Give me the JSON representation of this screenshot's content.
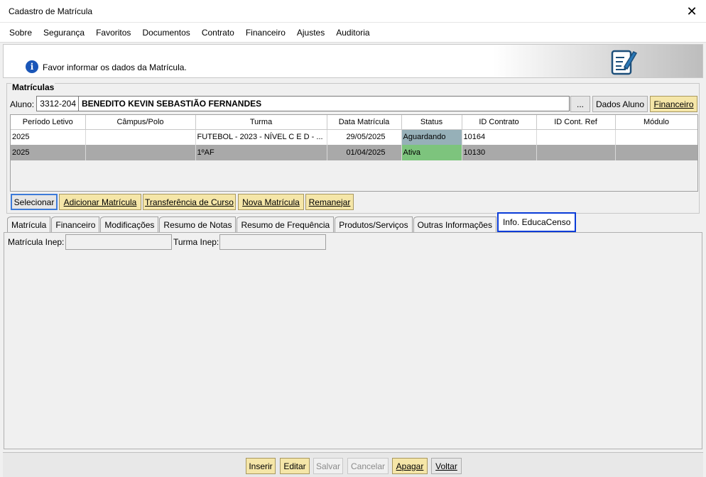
{
  "window": {
    "title": "Cadastro de Matrícula"
  },
  "menu": [
    {
      "label": "Sobre"
    },
    {
      "label": "Segurança"
    },
    {
      "label": "Favoritos"
    },
    {
      "label": "Documentos"
    },
    {
      "label": "Contrato"
    },
    {
      "label": "Financeiro"
    },
    {
      "label": "Ajustes"
    },
    {
      "label": "Auditoria"
    }
  ],
  "info": {
    "message": "Favor informar os dados da Matrícula.",
    "icon": "info-icon"
  },
  "matriculas": {
    "legend": "Matrículas",
    "aluno_label": "Aluno:",
    "aluno_code": "3312-204",
    "aluno_name": "BENEDITO KEVIN SEBASTIÃO FERNANDES",
    "ellipsis_label": "...",
    "dados_aluno_label": "Dados Aluno",
    "financeiro_label": "Financeiro",
    "columns": [
      "Período Letivo",
      "Câmpus/Polo",
      "Turma",
      "Data Matrícula",
      "Status",
      "ID Contrato",
      "ID Cont. Ref",
      "Módulo"
    ],
    "rows": [
      {
        "periodo": "2025",
        "campus": "",
        "turma": "FUTEBOL - 2023 - NÍVEL C E D - ...",
        "data": "29/05/2025",
        "status": "Aguardando",
        "id_contrato": "10164",
        "id_ref": "",
        "modulo": ""
      },
      {
        "periodo": "2025",
        "campus": "",
        "turma": "1ºAF",
        "data": "01/04/2025",
        "status": "Ativa",
        "id_contrato": "10130",
        "id_ref": "",
        "modulo": ""
      }
    ],
    "actions": {
      "selecionar": "Selecionar",
      "adicionar": "Adicionar Matrícula",
      "transferencia": "Transferência de Curso",
      "nova": "Nova Matrícula",
      "remanejar": "Remanejar"
    }
  },
  "tabs": [
    {
      "label": "Matrícula"
    },
    {
      "label": "Financeiro"
    },
    {
      "label": "Modificações"
    },
    {
      "label": "Resumo de Notas"
    },
    {
      "label": "Resumo de Frequência"
    },
    {
      "label": "Produtos/Serviços"
    },
    {
      "label": "Outras Informações"
    },
    {
      "label": "Info. EducaCenso",
      "active": true
    }
  ],
  "educacenso": {
    "matricula_inep_label": "Matrícula Inep:",
    "matricula_inep_value": "",
    "turma_inep_label": "Turma Inep:",
    "turma_inep_value": ""
  },
  "bottom": {
    "inserir": "Inserir",
    "editar": "Editar",
    "salvar": "Salvar",
    "cancelar": "Cancelar",
    "apagar": "Apagar",
    "voltar": "Voltar"
  },
  "colors": {
    "active_tab_border": "#0a3cd8",
    "status_waiting": "#96b0b8",
    "status_active": "#7dc47d",
    "yellow_button": "#f5e6a8"
  }
}
